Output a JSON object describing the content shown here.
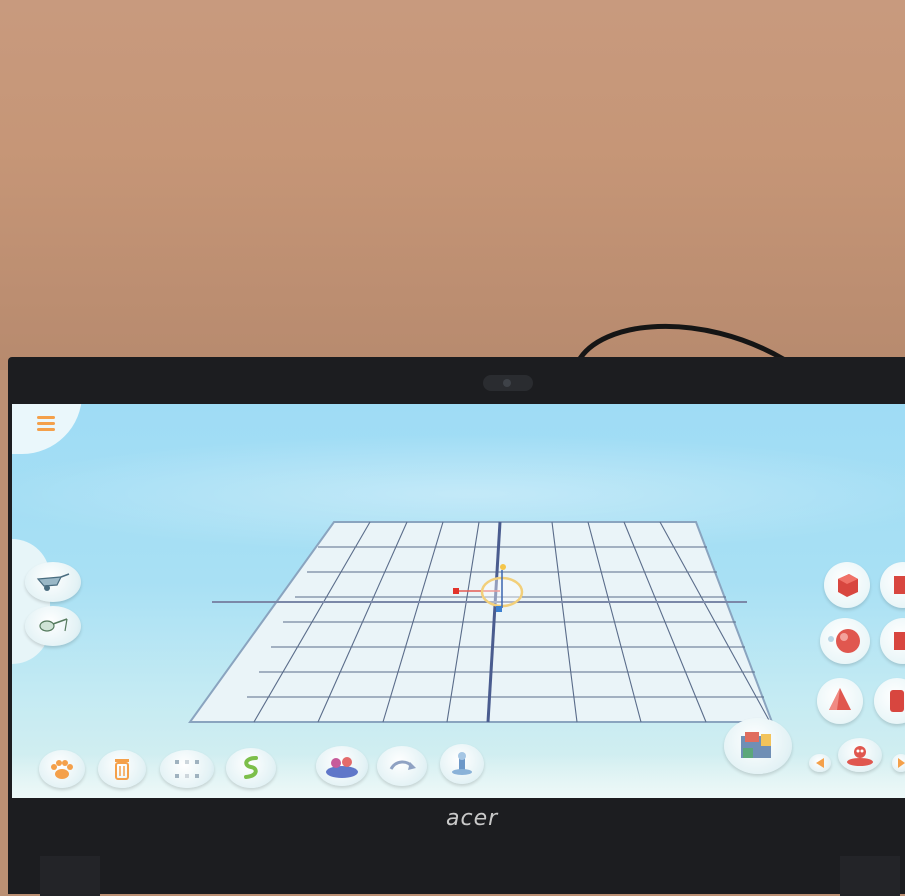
{
  "laptop": {
    "brand_label": "acer"
  },
  "app": {
    "menu": {
      "icon": "hamburger-icon"
    },
    "left_tools": [
      {
        "name": "wheelbarrow-tool",
        "icon": "wheelbarrow-icon"
      },
      {
        "name": "watering-tool",
        "icon": "watering-can-icon"
      }
    ],
    "bottom_toolbar": [
      {
        "name": "paw-button",
        "icon": "paw-icon"
      },
      {
        "name": "delete-button",
        "icon": "trash-icon"
      },
      {
        "name": "grid-toggle-button",
        "icon": "grid-dots-icon"
      },
      {
        "name": "snake-button",
        "icon": "snake-icon"
      },
      {
        "name": "scenery-button",
        "icon": "scenery-icon"
      },
      {
        "name": "rotate-button",
        "icon": "rotate-arrow-icon"
      },
      {
        "name": "fountain-button",
        "icon": "fountain-icon"
      }
    ],
    "shape_palette": [
      {
        "name": "cube-shape",
        "icon": "cube-icon"
      },
      {
        "name": "sphere-shape",
        "icon": "sphere-icon"
      },
      {
        "name": "cone-shape",
        "icon": "cone-icon"
      },
      {
        "name": "cylinder-shape",
        "icon": "cylinder-icon"
      }
    ],
    "colors": {
      "shape_red": "#e0574f",
      "accent_orange": "#f4a04a",
      "grid_line": "#5a6c8a"
    }
  }
}
